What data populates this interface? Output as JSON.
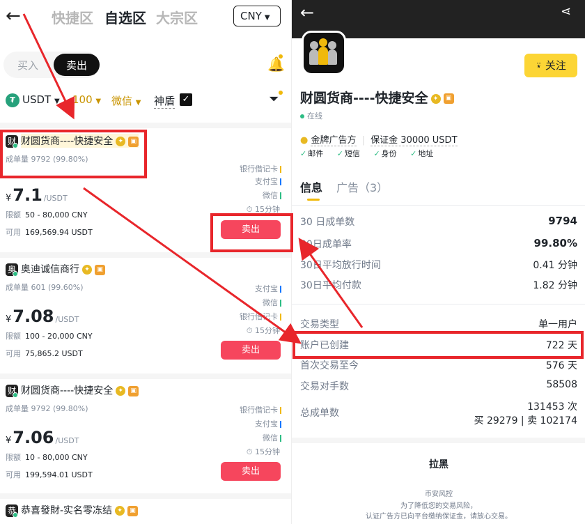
{
  "left": {
    "zones": [
      "快捷区",
      "自选区",
      "大宗区"
    ],
    "currency": "CNY",
    "segment": {
      "buy": "买入",
      "sell": "卖出"
    },
    "filters": {
      "asset": "USDT",
      "amount": "100",
      "payment": "微信",
      "shield": "神盾"
    },
    "merchants": [
      {
        "avatar_char": "财",
        "name": "财圆货商----快捷安全",
        "stats_label": "成单量",
        "stats_value": "9792 (99.80%)",
        "payments": [
          "银行借记卡",
          "支付宝",
          "微信"
        ],
        "price_symbol": "¥",
        "price": "7.1",
        "price_unit": "/USDT",
        "limit_label": "限额",
        "limit": "50 - 80,000 CNY",
        "available_label": "可用",
        "available": "169,569.94 USDT",
        "time": "15分钟",
        "action": "卖出"
      },
      {
        "avatar_char": "奥",
        "name": "奥迪诚信商行",
        "stats_label": "成单量",
        "stats_value": "601 (99.60%)",
        "payments": [
          "支付宝",
          "微信",
          "银行借记卡"
        ],
        "price_symbol": "¥",
        "price": "7.08",
        "price_unit": "/USDT",
        "limit_label": "限额",
        "limit": "100 - 20,000 CNY",
        "available_label": "可用",
        "available": "75,865.2 USDT",
        "time": "15分钟",
        "action": "卖出"
      },
      {
        "avatar_char": "财",
        "name": "财圆货商----快捷安全",
        "stats_label": "成单量",
        "stats_value": "9792 (99.80%)",
        "payments": [
          "银行借记卡",
          "支付宝",
          "微信"
        ],
        "price_symbol": "¥",
        "price": "7.06",
        "price_unit": "/USDT",
        "limit_label": "限额",
        "limit": "10 - 80,000 CNY",
        "available_label": "可用",
        "available": "199,594.01 USDT",
        "time": "15分钟",
        "action": "卖出"
      },
      {
        "avatar_char": "恭",
        "name": "恭喜發財-实名零冻结"
      }
    ]
  },
  "right": {
    "follow": "关注",
    "name": "财圆货商----快捷安全",
    "status": "在线",
    "tag_gold": "金牌广告方",
    "tag_deposit": "保证金 30000 USDT",
    "verifications": [
      "邮件",
      "短信",
      "身份",
      "地址"
    ],
    "tab_info": "信息",
    "tab_ads": "广告（3）",
    "stats": [
      {
        "k": "30 日成单数",
        "v": "9794"
      },
      {
        "k": "30日成单率",
        "v": "99.80%"
      },
      {
        "k": "30日平均放行时间",
        "v": "0.41 分钟"
      },
      {
        "k": "30日平均付款",
        "v": "1.82 分钟"
      }
    ],
    "details": [
      {
        "k": "交易类型",
        "v": "单一用户"
      },
      {
        "k": "账户已创建",
        "v": "722 天"
      },
      {
        "k": "首次交易至今",
        "v": "576 天"
      },
      {
        "k": "交易对手数",
        "v": "58508"
      }
    ],
    "total_label": "总成单数",
    "total_value": "131453 次",
    "total_split": "买 29279 | 卖 102174",
    "block": "拉黑",
    "risk_title": "币安风控",
    "risk_line1": "为了降低您的交易风险，",
    "risk_line2": "认证广告方已向平台缴纳保证金，请放心交易。"
  },
  "colors": {
    "accent_yellow": "#fcd535",
    "sell_red": "#f6465d",
    "annotation_red": "#e8262b",
    "online_green": "#2ebd85"
  }
}
